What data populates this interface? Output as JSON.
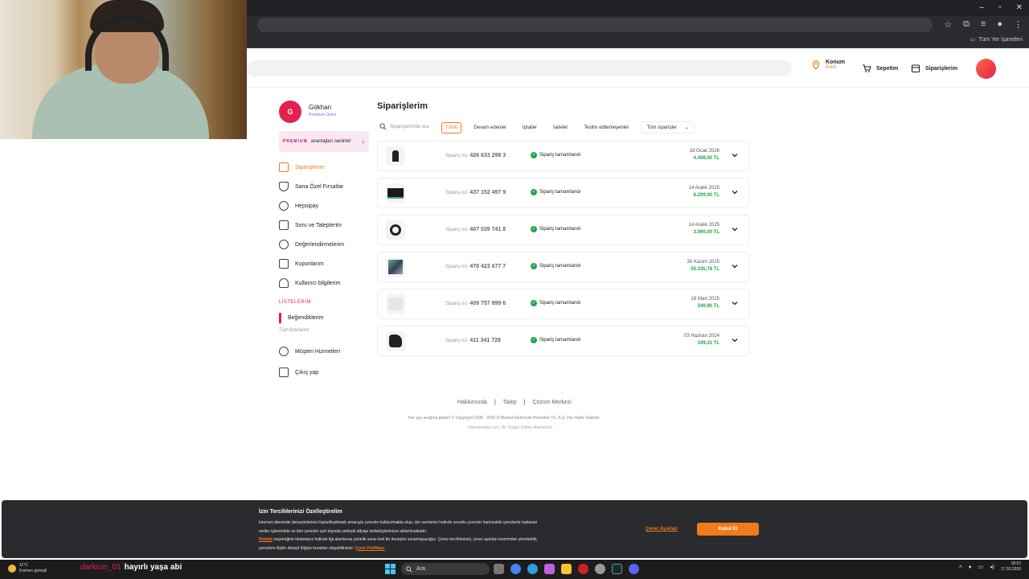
{
  "browser": {
    "bookmarks_all": "Tüm Yer İşaretleri"
  },
  "header": {
    "location_title": "Konum",
    "location_sub": "Evim",
    "cart": "Sepetim",
    "orders": "Siparişlerim"
  },
  "user": {
    "initial": "G",
    "name": "Gökhan",
    "subtitle": "Premium Üyesi"
  },
  "premium": {
    "brand": "PREMIUM",
    "text": "avantajları seninle!"
  },
  "sidebar": {
    "items": [
      {
        "label": "Siparişlerim"
      },
      {
        "label": "Sana Özel Fırsatlar"
      },
      {
        "label": "Hepsipay"
      },
      {
        "label": "Soru ve Taleplerim"
      },
      {
        "label": "Değerlendirmelerim"
      },
      {
        "label": "Kuponlarım"
      },
      {
        "label": "Kullanıcı bilgilerim"
      }
    ],
    "lists_title": "LİSTELERİM",
    "liked": "Beğendiklerim",
    "all_lists": "Tüm listelerim",
    "customer_service": "Müşteri Hizmetleri",
    "logout": "Çıkış yap"
  },
  "main": {
    "title": "Siparişlerim",
    "search_placeholder": "Siparişlerimde ara",
    "filters": [
      "Tümü",
      "Devam edenler",
      "İptaller",
      "İadeler",
      "Teslim edilemeyenler"
    ],
    "filter_dropdown": "Tüm siparişler",
    "order_no_label": "Sipariş no:",
    "orders": [
      {
        "no": "426 633 298 3",
        "status": "Sipariş tamamlandı",
        "date": "18 Ocak 2026",
        "price": "4.499,00 TL"
      },
      {
        "no": "437 152 497 9",
        "status": "Sipariş tamamlandı",
        "date": "14 Aralık 2025",
        "price": "8.299,00 TL"
      },
      {
        "no": "407 039 741 8",
        "status": "Sipariş tamamlandı",
        "date": "14 Aralık 2025",
        "price": "3.990,00 TL"
      },
      {
        "no": "478 423 677 7",
        "status": "Sipariş tamamlandı",
        "date": "30 Kasım 2025",
        "price": "55.335,78 TL"
      },
      {
        "no": "409 757 899 6",
        "status": "Sipariş tamamlandı",
        "date": "16 Mart 2025",
        "price": "349,90 TL"
      },
      {
        "no": "411 341 728",
        "status": "Sipariş tamamlandı",
        "date": "03 Haziran 2024",
        "price": "199,31 TL"
      }
    ]
  },
  "footer": {
    "links": [
      "Hakkımızda",
      "Talep",
      "Çözüm Merkezi"
    ],
    "copyright": "Her şey avağına gelsin! © Copyright 1998 - 2026 D-Market Elektronik Hizmetler Tic. A.Ş. Her Hakkı Saklıdır.",
    "sub": "Hepsiburada.com, Bir Doğan Online Markasıdır."
  },
  "cookie": {
    "title": "İzin Tercihlerinizi Özelleştirelim",
    "text1": "İnternet sitemizde deneyimlerinizi kişiselleştirmek amacıyla çerezler kullanılmakta olup, izin vermeniz halinde zorunlu çerezler haricindeki çerezlerle toplanan",
    "text2": "veriler işlenmekte ve tüm çerezler yurt dışında yerleşik altyapı tedarikçilerimize aktarılmaktadır.",
    "reject": "Reddet",
    "text3": "seçeneğine tıklamanız halinde ilgi alanlarına yönelik sana özel bir deneyim sunamayacağız. Çerez tercihlerinizi, çerez ayarları kısmından yönetebilir,",
    "text4": "çerezlere ilişkin detaylı bilgiye buradan ulaşabilirsiniz:",
    "policy": "Çerez Politikası",
    "settings": "Çerez Ayarları",
    "accept": "Kabul Et"
  },
  "taskbar": {
    "temp": "11°C",
    "weather": "Kısmen güneşli",
    "search": "Ara",
    "time": "18:52",
    "date": "17.03.2026"
  },
  "chat": {
    "user": "darkrun_01",
    "message": "hayırlı yaşa abi"
  },
  "colors": {
    "accent": "#f27a1a",
    "brand_pink": "#e3204f",
    "success": "#21a54a"
  }
}
